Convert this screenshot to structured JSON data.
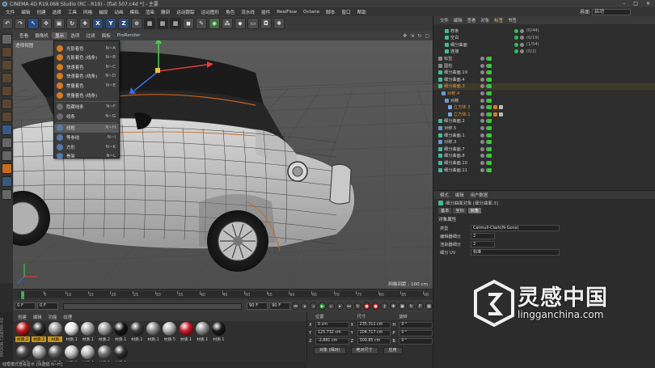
{
  "window": {
    "title": "CINEMA 4D R19.068 Studio (RC - R19) - [fiat 507.c4d *] - 主要",
    "controls": [
      "–",
      "□",
      "✕"
    ]
  },
  "menubar": {
    "items": [
      "文件",
      "编辑",
      "创建",
      "选择",
      "工具",
      "网格",
      "捕捉",
      "动画",
      "模拟",
      "渲染",
      "雕刻",
      "运动跟踪",
      "运动图形",
      "角色",
      "流水线",
      "插件",
      "RealFlow",
      "Octane",
      "脚本",
      "窗口",
      "帮助"
    ],
    "layout_label": "界面",
    "layout_value": "启动"
  },
  "toolbar": {
    "undo": "↶",
    "axes": [
      "X",
      "Y",
      "Z"
    ]
  },
  "viewport": {
    "menus": [
      "查看",
      "摄像机",
      "显示",
      "选项",
      "过滤",
      "面板",
      "ProRender"
    ],
    "active_menu": "显示",
    "label": "透视视图",
    "grid_size": "网格间距 : 100 cm"
  },
  "display_menu": {
    "items": [
      {
        "label": "光影着色",
        "shortcut": "N~A",
        "icon": "orange"
      },
      {
        "label": "光影着色 (线条)",
        "shortcut": "N~B",
        "icon": "orange"
      },
      {
        "label": "快速着色",
        "shortcut": "N~C",
        "icon": "orange"
      },
      {
        "label": "快速着色 (线条)",
        "shortcut": "N~D",
        "icon": "orange"
      },
      {
        "label": "常量着色",
        "shortcut": "N~E",
        "icon": "orange"
      },
      {
        "label": "常量着色 (线条)",
        "shortcut": "",
        "icon": "orange"
      },
      {
        "label": "隐藏线条",
        "shortcut": "N~F",
        "icon": "gray"
      },
      {
        "label": "线条",
        "shortcut": "N~G",
        "icon": "gray"
      },
      {
        "label": "线框",
        "shortcut": "N~H",
        "icon": "blue"
      },
      {
        "label": "等参线",
        "shortcut": "N~I",
        "icon": "blue"
      },
      {
        "label": "方形",
        "shortcut": "N~K",
        "icon": "blue"
      },
      {
        "label": "骨架",
        "shortcut": "N~L",
        "icon": "blue"
      }
    ],
    "highlighted": "线框"
  },
  "timeline": {
    "ticks": [
      "0",
      "5",
      "10",
      "15",
      "20",
      "25",
      "30",
      "35",
      "40",
      "45",
      "50",
      "55",
      "60",
      "65",
      "70",
      "75",
      "80",
      "85",
      "90"
    ],
    "end_label": "0 F"
  },
  "transport": {
    "current": "0 F",
    "start": "0 F",
    "end": "90 F",
    "max": "90 F"
  },
  "materials": {
    "tabs": [
      "创建",
      "编辑",
      "功能",
      "纹理"
    ],
    "items": [
      {
        "label": "材质.2",
        "color": "#c01818",
        "selected": true
      },
      {
        "label": "材质.1",
        "color": "#2a2a2a",
        "selected": true
      },
      {
        "label": "材质",
        "color": "#9a9a9a",
        "selected": true
      },
      {
        "label": "材质.1",
        "color": "#e8e8e8",
        "selected": false
      },
      {
        "label": "材质.1",
        "color": "#a8a8a8",
        "selected": false
      },
      {
        "label": "材质.2",
        "color": "#9a9a9a",
        "selected": false
      },
      {
        "label": "材质.1",
        "color": "#151515",
        "selected": false
      },
      {
        "label": "材质.1",
        "color": "#3a3a3a",
        "selected": false
      },
      {
        "label": "材质.1",
        "color": "#888888",
        "selected": false
      },
      {
        "label": "材质.5",
        "color": "#b0b0b0",
        "selected": false
      },
      {
        "label": "材质.1",
        "color": "#d0182a",
        "selected": false
      },
      {
        "label": "材质.1",
        "color": "#909090",
        "selected": false
      },
      {
        "label": "材质.1",
        "color": "#1a1a1a",
        "selected": false
      },
      {
        "label": "材质.6",
        "color": "#4a4a4a",
        "selected": false
      },
      {
        "label": "材质.1",
        "color": "#a0a0a0",
        "selected": false
      },
      {
        "label": "材质.3",
        "color": "#606060",
        "selected": false
      },
      {
        "label": "材质.1",
        "color": "#c0c0c0",
        "selected": false
      },
      {
        "label": "材质.4",
        "color": "#b8b8b8",
        "selected": false
      },
      {
        "label": "材质.1",
        "color": "#707070",
        "selected": false
      },
      {
        "label": "材质.1",
        "color": "#2e2e2e",
        "selected": false
      }
    ]
  },
  "coords": {
    "headers": [
      "位置",
      "尺寸",
      "旋转"
    ],
    "rows": [
      {
        "axis": "X",
        "pos": "0 cm",
        "size": "235.311 cm",
        "rot_axis": "H",
        "rot": "0 °"
      },
      {
        "axis": "Y",
        "pos": "125.732 cm",
        "size": "104.717 cm",
        "rot_axis": "P",
        "rot": "0 °"
      },
      {
        "axis": "Z",
        "pos": "-2.881 cm",
        "size": "300.85 cm",
        "rot_axis": "B",
        "rot": "0 °"
      }
    ],
    "mode": "对象 (相对)",
    "size_mode": "绝对尺寸",
    "apply": "应用"
  },
  "status": "线框模式查看显示 [快捷键 N~H]",
  "side_brand": "MAXON CINEMA 4D",
  "objects": {
    "tabs": [
      "文件",
      "编辑",
      "查看",
      "对象",
      "标签",
      "书签"
    ],
    "active_tab": "标签",
    "rows": [
      {
        "name": "样条",
        "count": "(0/44)",
        "indent": 3,
        "style": ""
      },
      {
        "name": "空白",
        "count": "(0/19)",
        "indent": 3,
        "style": ""
      },
      {
        "name": "细分曲面",
        "count": "(1/54)",
        "indent": 3,
        "style": ""
      },
      {
        "name": "连接",
        "count": "(0/2)",
        "indent": 3,
        "style": ""
      },
      {
        "name": "标签",
        "count": "",
        "indent": 1,
        "style": ""
      },
      {
        "name": "圆柱",
        "count": "",
        "indent": 1,
        "style": ""
      },
      {
        "name": "细分曲面.19",
        "count": "",
        "indent": 1,
        "style": ""
      },
      {
        "name": "细分曲面.4",
        "count": "",
        "indent": 1,
        "style": ""
      },
      {
        "name": "细分曲面.3",
        "count": "",
        "indent": 1,
        "style": "orange"
      },
      {
        "name": "对称.4",
        "count": "",
        "indent": 2,
        "style": "orange"
      },
      {
        "name": "对称",
        "count": "",
        "indent": 3,
        "style": ""
      },
      {
        "name": "立方体.3",
        "count": "",
        "indent": 4,
        "style": "orange"
      },
      {
        "name": "立方体.1",
        "count": "",
        "indent": 4,
        "style": "orange"
      },
      {
        "name": "细分曲面.2",
        "count": "",
        "indent": 1,
        "style": ""
      },
      {
        "name": "对称.5",
        "count": "",
        "indent": 1,
        "style": ""
      },
      {
        "name": "细分曲面.1",
        "count": "",
        "indent": 1,
        "style": ""
      },
      {
        "name": "对称.3",
        "count": "",
        "indent": 1,
        "style": ""
      },
      {
        "name": "细分曲面.7",
        "count": "",
        "indent": 1,
        "style": ""
      },
      {
        "name": "细分曲面.8",
        "count": "",
        "indent": 1,
        "style": ""
      },
      {
        "name": "细分曲面.10",
        "count": "",
        "indent": 1,
        "style": ""
      },
      {
        "name": "细分曲面.11",
        "count": "",
        "indent": 1,
        "style": ""
      }
    ]
  },
  "attributes": {
    "tabs": [
      "模式",
      "编辑",
      "用户数据"
    ],
    "object_name": "细分曲面对象 [细分曲面.3]",
    "subtabs": [
      "基本",
      "坐标",
      "对象"
    ],
    "section": "对象属性",
    "rows": [
      {
        "label": "类型",
        "value": "Catmull-Clark(N-Gons)"
      },
      {
        "label": "编辑器细分",
        "value": "2"
      },
      {
        "label": "渲染器细分",
        "value": "2"
      },
      {
        "label": "细分 UV",
        "value": "标准"
      }
    ]
  },
  "watermark": {
    "cn": "灵感中国",
    "en": "lingganchina.com"
  }
}
